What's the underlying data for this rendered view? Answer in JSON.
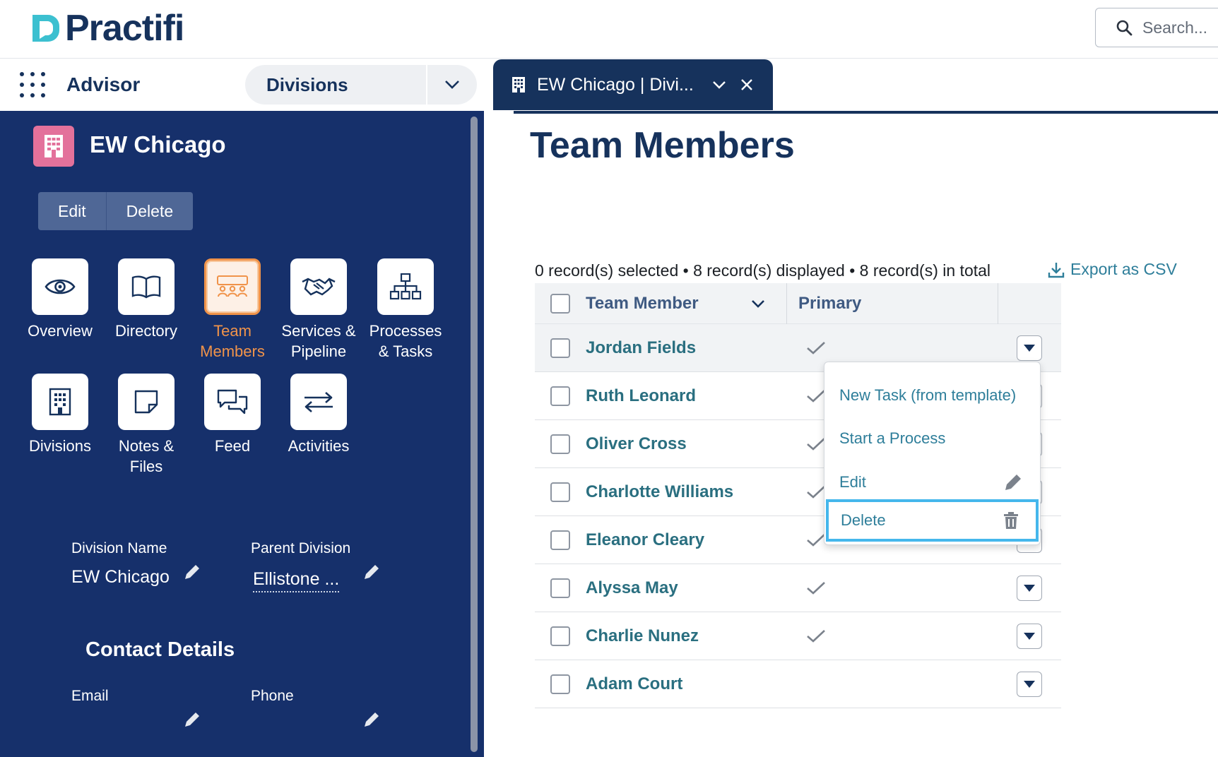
{
  "header": {
    "brand": "Practifi",
    "search_placeholder": "Search..."
  },
  "nav": {
    "app_name": "Advisor",
    "object_selector": "Divisions",
    "tab_label": "EW Chicago | Divi..."
  },
  "record": {
    "title": "EW Chicago",
    "actions": [
      "Edit",
      "Delete"
    ],
    "tiles": [
      {
        "label1": "Overview",
        "label2": "",
        "icon": "eye-icon"
      },
      {
        "label1": "Directory",
        "label2": "",
        "icon": "book-icon"
      },
      {
        "label1": "Team",
        "label2": "Members",
        "icon": "team-icon",
        "active": true
      },
      {
        "label1": "Services &",
        "label2": "Pipeline",
        "icon": "handshake-icon"
      },
      {
        "label1": "Processes",
        "label2": "& Tasks",
        "icon": "hierarchy-icon"
      },
      {
        "label1": "Divisions",
        "label2": "",
        "icon": "building-icon"
      },
      {
        "label1": "Notes &",
        "label2": "Files",
        "icon": "note-icon"
      },
      {
        "label1": "Feed",
        "label2": "",
        "icon": "chat-icon"
      },
      {
        "label1": "Activities",
        "label2": "",
        "icon": "arrows-icon"
      }
    ],
    "fields": {
      "division_name_label": "Division Name",
      "division_name_value": "EW Chicago",
      "parent_division_label": "Parent Division",
      "parent_division_value": "Ellistone ...",
      "contact_section": "Contact Details",
      "email_label": "Email",
      "phone_label": "Phone"
    }
  },
  "main": {
    "title": "Team Members",
    "summary": "0 record(s) selected • 8 record(s) displayed • 8 record(s) in total",
    "export_label": "Export as CSV",
    "columns": [
      "Team Member",
      "Primary"
    ],
    "rows": [
      {
        "name": "Jordan Fields",
        "primary": true
      },
      {
        "name": "Ruth Leonard",
        "primary": true
      },
      {
        "name": "Oliver Cross",
        "primary": true
      },
      {
        "name": "Charlotte Williams",
        "primary": true
      },
      {
        "name": "Eleanor Cleary",
        "primary": true
      },
      {
        "name": "Alyssa May",
        "primary": true
      },
      {
        "name": "Charlie Nunez",
        "primary": true
      },
      {
        "name": "Adam Court",
        "primary": false
      }
    ],
    "row_menu": [
      "New Task (from template)",
      "Start a Process",
      "Edit",
      "Delete"
    ]
  },
  "colors": {
    "navy": "#16325c",
    "sidebar": "#16306b",
    "teal_link": "#2e7e9a",
    "accent_orange": "#f0934a",
    "record_icon": "#e3719b",
    "focus_ring": "#45b7ec"
  }
}
